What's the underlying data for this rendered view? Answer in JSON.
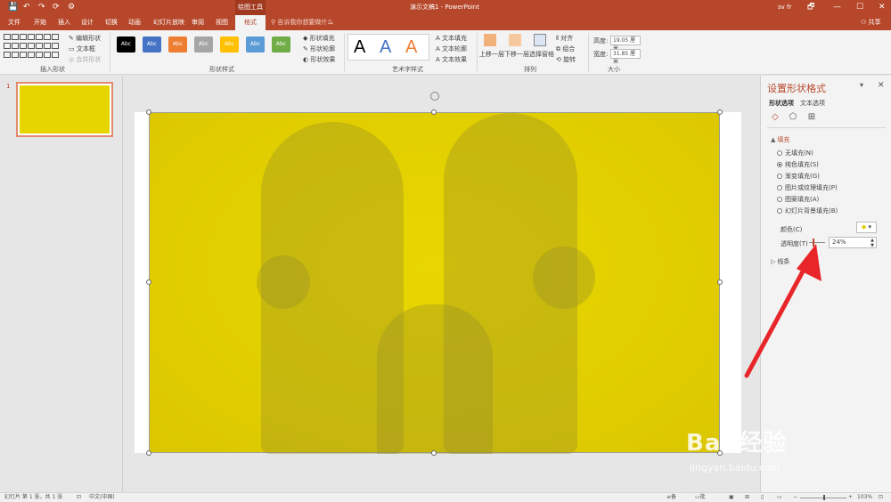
{
  "titlebar": {
    "quick_access": [
      "💾",
      "↶",
      "↷",
      "⟳",
      "⚙"
    ],
    "context_tools": "绘图工具",
    "title": "演示文稿1  -  PowerPoint",
    "user": "sv fr",
    "window_buttons": [
      "🗗",
      "—",
      "☐",
      "✕"
    ]
  },
  "tabs": {
    "items": [
      "文件",
      "开始",
      "插入",
      "设计",
      "切换",
      "动画",
      "幻灯片放映",
      "审阅",
      "视图",
      "格式"
    ],
    "active": "格式",
    "tell_me": "告诉我你想要做什么",
    "share": "共享"
  },
  "ribbon": {
    "groups": [
      "插入形状",
      "形状样式",
      "艺术字样式",
      "排列",
      "大小"
    ],
    "insert_shapes": {
      "edit_shape": "编辑形状",
      "text_box": "文本框",
      "merge_shapes": "合并形状"
    },
    "shape_styles": {
      "swatch_label": "Abc",
      "swatch_colors": [
        "#000000",
        "#4472c4",
        "#ed7d31",
        "#a5a5a5",
        "#ffc000",
        "#5b9bd5",
        "#70ad47"
      ],
      "fill": "形状填充",
      "outline": "形状轮廓",
      "effects": "形状效果"
    },
    "wordart": {
      "letters": [
        "A",
        "A",
        "A"
      ],
      "letter_colors": [
        "#000000",
        "#4472c4",
        "#ed7d31"
      ],
      "text_fill": "文本填充",
      "text_outline": "文本轮廓",
      "text_effects": "文本效果"
    },
    "arrange": {
      "bring_forward": "上移一层",
      "send_backward": "下移一层",
      "selection_pane": "选择窗格",
      "align": "对齐",
      "group": "组合",
      "rotate": "旋转"
    },
    "size": {
      "height_label": "高度:",
      "height_value": "19.05 厘米",
      "width_label": "宽度:",
      "width_value": "31.85 厘米"
    }
  },
  "thumbnails": {
    "slide_number": "1"
  },
  "watermark": {
    "main": "Bai 经验",
    "sub": "jingyan.baidu.com"
  },
  "pane": {
    "title": "设置形状格式",
    "tabs": [
      "形状选项",
      "文本选项"
    ],
    "icons": [
      "fill-line-icon",
      "effects-icon",
      "size-properties-icon"
    ],
    "fill_section": "填充",
    "fill_options": [
      "无填充(N)",
      "纯色填充(S)",
      "渐变填充(G)",
      "图片或纹理填充(P)",
      "图案填充(A)",
      "幻灯片背景填充(B)"
    ],
    "fill_selected_index": 1,
    "color_label": "颜色(C)",
    "transparency_label": "透明度(T)",
    "transparency_value": "24%",
    "transparency_level": 0.24,
    "line_section": "线条"
  },
  "status": {
    "slide_info": "幻灯片 第 1 张，共 1 张",
    "language": "中文(中国)",
    "notes": "备注",
    "comments": "批注",
    "zoom": "103%"
  }
}
